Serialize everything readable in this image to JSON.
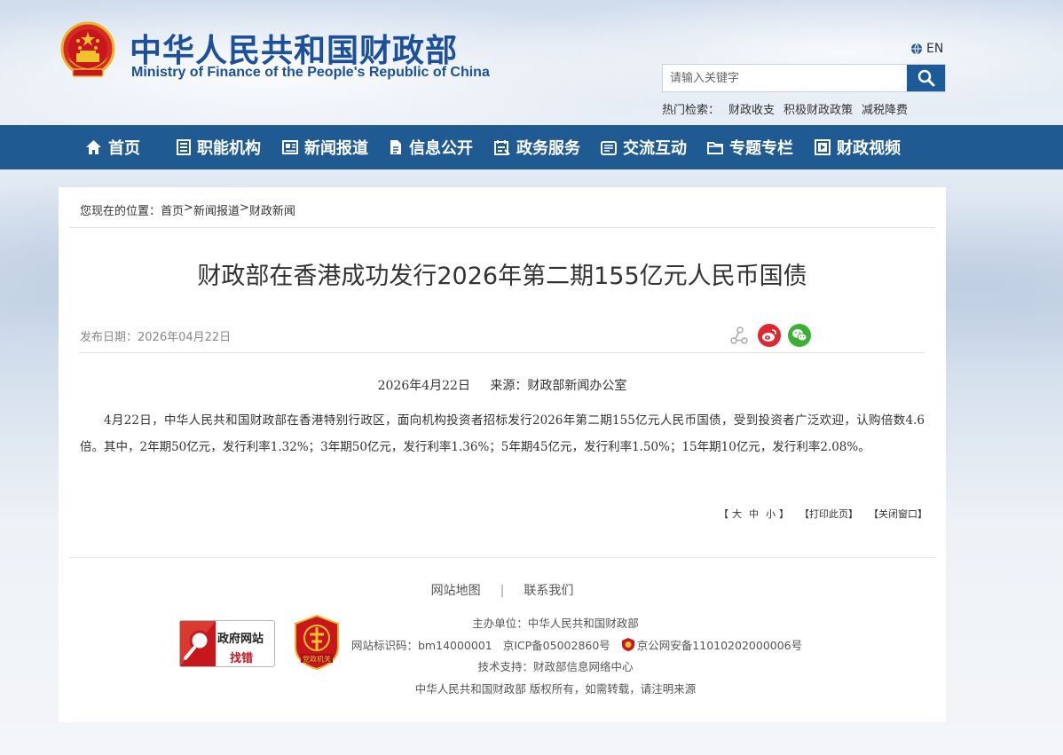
{
  "header": {
    "title_cn": "中华人民共和国财政部",
    "title_en": "Ministry of Finance of the People's Republic of China",
    "lang_label": "EN",
    "search": {
      "placeholder": "请输入关键字"
    },
    "hot_search": {
      "label": "热门检索：",
      "items": [
        "财政收支",
        "积极财政政策",
        "减税降费"
      ]
    }
  },
  "nav": {
    "items": [
      {
        "label": "首页",
        "icon": "home-icon"
      },
      {
        "label": "职能机构",
        "icon": "list-icon"
      },
      {
        "label": "新闻报道",
        "icon": "newspaper-icon"
      },
      {
        "label": "信息公开",
        "icon": "document-icon"
      },
      {
        "label": "政务服务",
        "icon": "service-icon"
      },
      {
        "label": "交流互动",
        "icon": "interact-icon"
      },
      {
        "label": "专题专栏",
        "icon": "folder-icon"
      },
      {
        "label": "财政视频",
        "icon": "video-icon"
      }
    ]
  },
  "breadcrumb": {
    "prefix": "您现在的位置：",
    "items": [
      "首页",
      "新闻报道",
      "财政新闻"
    ],
    "separator": ">"
  },
  "article": {
    "title": "财政部在香港成功发行2026年第二期155亿元人民币国债",
    "pub_label": "发布日期：",
    "pub_date": "2026年04月22日",
    "source_date": "2026年4月22日",
    "source": "来源：财政部新闻办公室",
    "body": "4月22日，中华人民共和国财政部在香港特别行政区，面向机构投资者招标发行2026年第二期155亿元人民币国债，受到投资者广泛欢迎，认购倍数4.6倍。其中，2年期50亿元，发行利率1.32%；3年期50亿元，发行利率1.36%；5年期45亿元，发行利率1.50%；15年期10亿元，发行利率2.08%。"
  },
  "share": {
    "icons": [
      "share-icon",
      "weibo-icon",
      "wechat-icon"
    ]
  },
  "tools": {
    "font_open": "【",
    "font_large": "大",
    "font_medium": "中",
    "font_small": "小",
    "font_close": "】",
    "print": "【打印此页】",
    "close": "【关闭窗口】"
  },
  "footer": {
    "links": [
      "网站地图",
      "联系我们"
    ],
    "gov_badge": {
      "line1": "政府网站",
      "line2": "找错"
    },
    "party_badge": {
      "text": "党政机关"
    },
    "host": "主办单位：中华人民共和国财政部",
    "site_id": "网站标识码：bm14000001",
    "icp": "京ICP备05002860号",
    "police": "京公网安备11010202000006号",
    "tech": "技术支持：财政部信息网络中心",
    "copyright": "中华人民共和国财政部  版权所有，如需转载，请注明来源"
  },
  "colors": {
    "brand_blue": "#1c4f9c",
    "nav_bg": "#1f5b92",
    "emblem_red": "#c8161d",
    "emblem_gold": "#f3c12b",
    "weibo_red": "#e0262e",
    "wechat_green": "#3cb034"
  }
}
